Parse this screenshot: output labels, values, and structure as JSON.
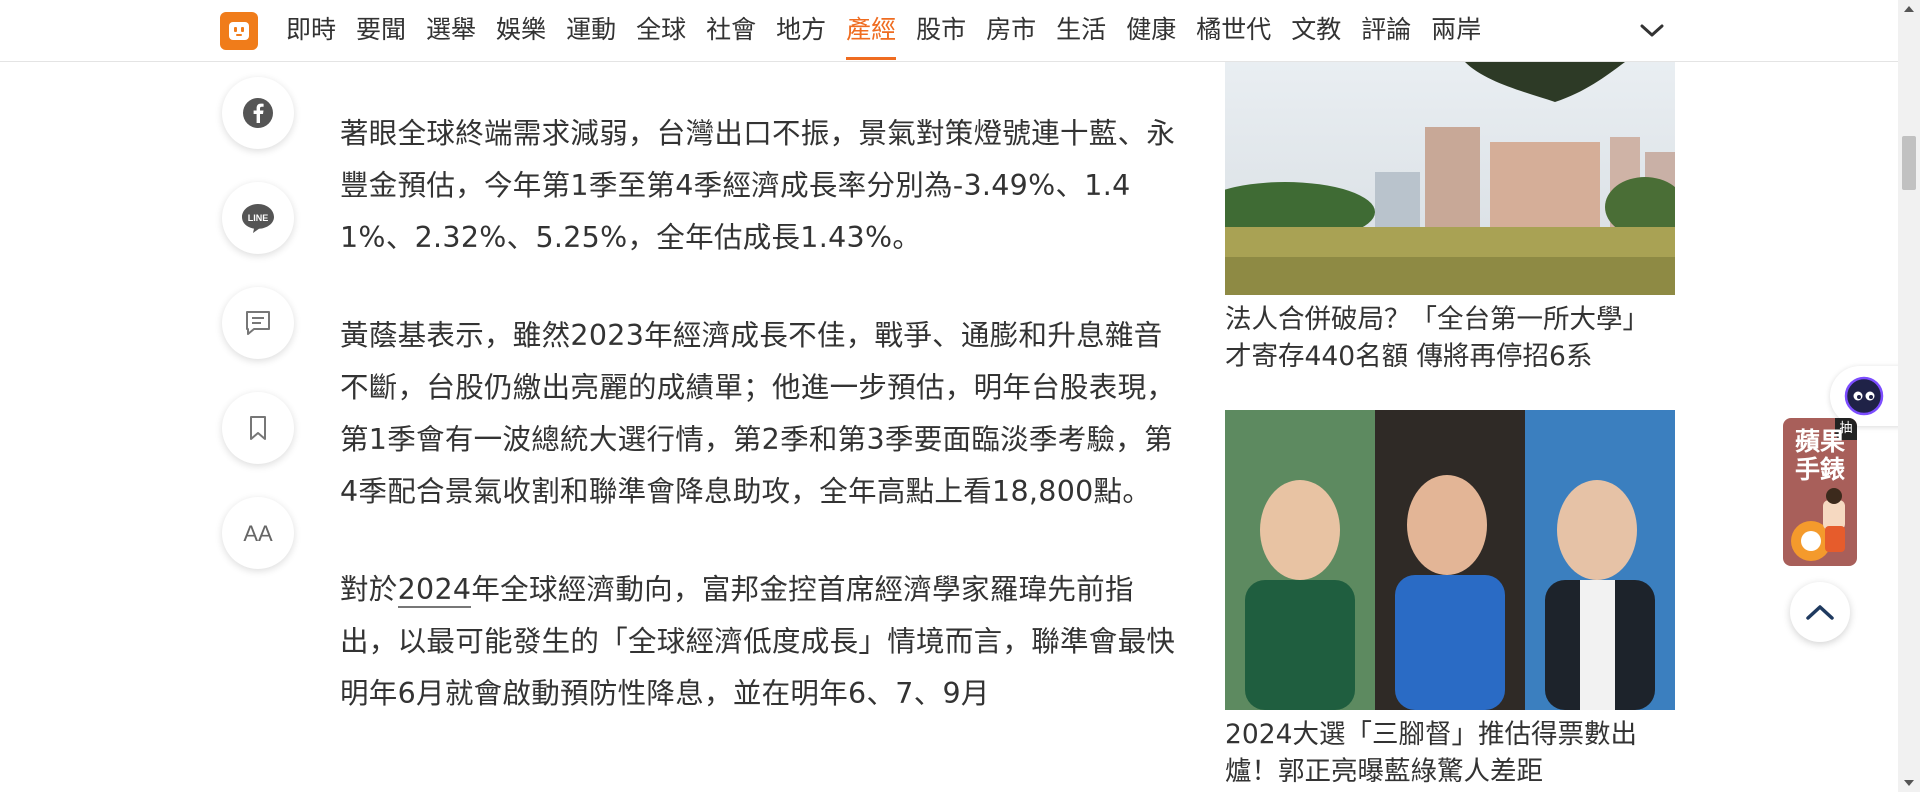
{
  "nav": {
    "items": [
      "即時",
      "要聞",
      "選舉",
      "娛樂",
      "運動",
      "全球",
      "社會",
      "地方",
      "產經",
      "股市",
      "房市",
      "生活",
      "健康",
      "橘世代",
      "文教",
      "評論",
      "兩岸"
    ],
    "active": "產經",
    "more_icon": "chevron-down-icon"
  },
  "share_rail": {
    "icons": [
      "facebook-icon",
      "line-icon",
      "comment-icon",
      "bookmark-icon",
      "font-size-icon"
    ],
    "line_label": "LINE",
    "font_label": "AA"
  },
  "article": {
    "p1": "著眼全球終端需求減弱，台灣出口不振，景氣對策燈號連十藍、永豐金預估，今年第1季至第4季經濟成長率分別為-3.49%、1.41%、2.32%、5.25%，全年估成長1.43%。",
    "p2": "黃蔭基表示，雖然2023年經濟成長不佳，戰爭、通膨和升息雜音不斷，台股仍繳出亮麗的成績單；他進一步預估，明年台股表現，第1季會有一波總統大選行情，第2季和第3季要面臨淡季考驗，第4季配合景氣收割和聯準會降息助攻，全年高點上看18,800點。",
    "p3_before": "對於",
    "p3_link": "2024",
    "p3_after": "年全球經濟動向，富邦金控首席經濟學家羅瑋先前指出，以最可能發生的「全球經濟低度成長」情境而言，聯準會最快明年6月就會啟動預防性降息，並在明年6、7、9月"
  },
  "related": [
    {
      "caption": "法人合併破局？「全台第一所大學」才寄存440名額 傳將再停招6系"
    },
    {
      "caption": "2024大選「三腳督」推估得票數出爐！郭正亮曝藍綠驚人差距"
    }
  ],
  "promo": {
    "tag": "抽",
    "line1": "蘋果",
    "line2": "手錶"
  },
  "colors": {
    "accent": "#ef6c20",
    "logo": "#f07c1a",
    "text": "#333333"
  }
}
